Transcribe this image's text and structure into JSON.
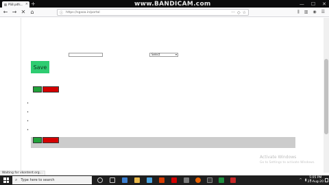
{
  "browser": {
    "tab_title": "PSB pdfs...",
    "tab_close": "×",
    "new_tab": "+",
    "url": "https://sgxoa.in/portal",
    "back_glyph": "←",
    "forward_glyph": "→",
    "stop_glyph": "✕",
    "home_glyph": "⌂",
    "window_controls": [
      "—",
      "☐",
      "✕"
    ]
  },
  "recorder_watermark": "www.BANDICAM.com",
  "form": {
    "text_input_value": "",
    "select_value": "Select",
    "select_arrow": "▾",
    "save_label": "Save"
  },
  "bullets": [
    "•",
    "•",
    "•",
    "•"
  ],
  "activation": {
    "title": "Activate Windows",
    "subtitle": "Go to Settings to activate Windows."
  },
  "status_bar": "Waiting for vkontent.org...",
  "taskbar": {
    "search_placeholder": "Type here to search",
    "time": "5:05 PM",
    "date": "21-Aug-20"
  },
  "colors": {
    "save_green": "#2ecc71",
    "swatch_green": "#21a13a",
    "swatch_red": "#d40000",
    "bar_gray": "#cccccc"
  }
}
